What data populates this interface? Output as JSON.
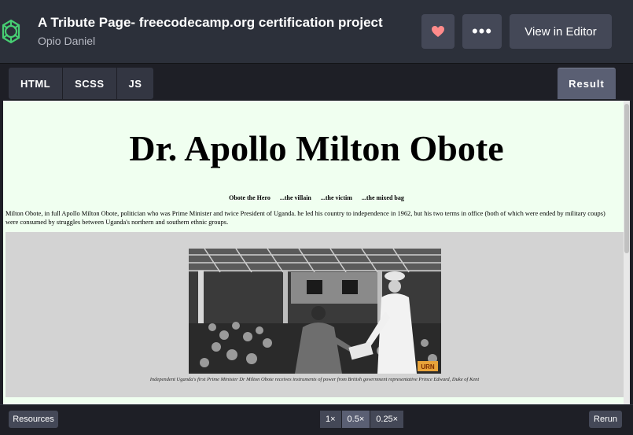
{
  "header": {
    "title": "A Tribute Page- freecodecamp.org certification project",
    "author": "Opio Daniel",
    "more_label": "•••",
    "editor_label": "View in Editor"
  },
  "tabs": [
    {
      "label": "HTML"
    },
    {
      "label": "SCSS"
    },
    {
      "label": "JS"
    }
  ],
  "result_tab": "Result",
  "page": {
    "heading": "Dr. Apollo Milton Obote",
    "nav": [
      "Obote the Hero",
      "...the villain",
      "...the victim",
      "...the mixed bag"
    ],
    "intro": "Milton Obote, in full Apollo Milton Obote, politician who was Prime Minister and twice President of Uganda. he led his country to independence in 1962, but his two terms in office (both of which were ended by military coups) were consumed by struggles between Uganda's northern and southern ethnic groups.",
    "caption": "Independent Uganda's first Prime Minister Dr Milton Obote receives instruments of power from British government representative Prince Edward, Duke of Kent",
    "photo_badge": "URN"
  },
  "footer": {
    "resources_label": "Resources",
    "zoom": [
      "1×",
      "0.5×",
      "0.25×"
    ],
    "zoom_selected": "0.5×",
    "rerun_label": "Rerun"
  },
  "colors": {
    "accent": "#47cf73",
    "heart": "#ff8b8b",
    "result_bg": "#f0fff0"
  }
}
